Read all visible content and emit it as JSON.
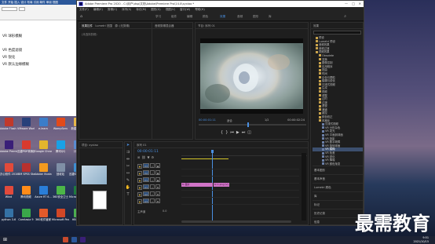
{
  "word": {
    "tab_labels": "文件  开始  插入  设计  布局  引用  邮件  审阅  视图",
    "lines": [
      "VR 球形模糊",
      "",
      "VR 色度滤镜",
      "VR 锐化",
      "VR 默认边缘模糊"
    ]
  },
  "desktop_icons": [
    {
      "label": "Adobe Flash Professio...",
      "color": "#c0392b"
    },
    {
      "label": "VMware Workstati...",
      "color": "#27407a"
    },
    {
      "label": "e-learn",
      "color": "#3b7dc9"
    },
    {
      "label": "WampServ",
      "color": "#e24a1b"
    },
    {
      "label": "新建文件夹",
      "color": "#e8b84a"
    },
    {
      "label": "Adobe Premiere ...",
      "color": "#3a1f78"
    },
    {
      "label": "迅捷PDF转换器 (v4.0)",
      "color": "#d83a2e"
    },
    {
      "label": "Google Chrome",
      "color": "#e3b52d"
    },
    {
      "label": "腾讯QQ",
      "color": "#1aa1e6"
    },
    {
      "label": "计算机",
      "color": "#5a8bd1"
    },
    {
      "label": "办公软件 2010",
      "color": "#e34a3a"
    },
    {
      "label": "IBM SPSS Statistics 20",
      "color": "#b8312f"
    },
    {
      "label": "Adobe Illustrat...",
      "color": "#f29a1f"
    },
    {
      "label": "回收站",
      "color": "#7f8fa6"
    },
    {
      "label": "迅捷OCR文字识别",
      "color": "#3e8ed0"
    },
    {
      "label": "Wind",
      "color": "#e14a3c"
    },
    {
      "label": "腾讯视频",
      "color": "#ff8c1a"
    },
    {
      "label": "Azure RT 6...",
      "color": "#2a7ed8"
    },
    {
      "label": "360安全卫士",
      "color": "#4cb648"
    },
    {
      "label": "Microsoft Excel 2010",
      "color": "#1e7b3f"
    },
    {
      "label": "python 3.6",
      "color": "#3572a5"
    },
    {
      "label": "Camtasia 9",
      "color": "#3aa84a"
    },
    {
      "label": "360软件管家",
      "color": "#e35a2a"
    },
    {
      "label": "Microsoft PowerPoint",
      "color": "#d24726"
    },
    {
      "label": "HBuilder",
      "color": "#4caf50"
    }
  ],
  "premiere": {
    "title": "Adobe Premiere Pro 2020 - C:\\用户\\dsp\\文档\\Adobe\\Premiere Pro\\14.0\\xyxiao *",
    "menu": [
      "文件(F)",
      "编辑(E)",
      "剪辑(C)",
      "序列(S)",
      "标记(M)",
      "图形(G)",
      "视图(V)",
      "窗口(W)",
      "帮助(H)"
    ],
    "workspaces": [
      "学习",
      "组件",
      "编辑",
      "颜色",
      "效果",
      "音频",
      "图形",
      "库"
    ],
    "active_workspace": "效果",
    "source_tabs": [
      "效果控件",
      "Lumetri 范围",
      "源: (无剪辑)"
    ],
    "source_empty": "(未选择剪辑)",
    "audio_mixer_tab": "音频剪辑混合器",
    "program_tab": "节目: 序列 01",
    "program_timecode": "00:00:01:11",
    "program_fit": "适合",
    "program_ratio": "1/2",
    "program_duration": "00:00:02:24",
    "project_tab": "项目: xyxiao",
    "timeline_tab": "序列 01",
    "timeline_timecode": "00:00:01:11",
    "tracks": [
      {
        "name": "V3"
      },
      {
        "name": "V2"
      },
      {
        "name": "V1"
      },
      {
        "name": "A1"
      },
      {
        "name": "A2"
      },
      {
        "name": "A3"
      }
    ],
    "master_label": "主声道",
    "master_value": "0.0",
    "clip_label_1": "fx 图片",
    "clip_label_2": "fx 1.png [V]",
    "clip_label_3": "fx 图片"
  },
  "effects_panel": {
    "tab": "效果",
    "search_placeholder": "",
    "items": [
      {
        "label": "预设",
        "indent": 1
      },
      {
        "label": "Lumetri 预设",
        "indent": 1
      },
      {
        "label": "音频效果",
        "indent": 1
      },
      {
        "label": "音频过渡",
        "indent": 1
      },
      {
        "label": "视频效果",
        "indent": 1
      },
      {
        "label": "Obsolete",
        "indent": 2
      },
      {
        "label": "变换",
        "indent": 2
      },
      {
        "label": "图像控制",
        "indent": 2
      },
      {
        "label": "实用程序",
        "indent": 2
      },
      {
        "label": "扭曲",
        "indent": 2
      },
      {
        "label": "时间",
        "indent": 2
      },
      {
        "label": "杂色与颗粒",
        "indent": 2
      },
      {
        "label": "模糊与锐化",
        "indent": 2
      },
      {
        "label": "沉浸式视频",
        "indent": 2
      },
      {
        "label": "生成",
        "indent": 2
      },
      {
        "label": "视频",
        "indent": 2
      },
      {
        "label": "调整",
        "indent": 2
      },
      {
        "label": "过时",
        "indent": 2
      },
      {
        "label": "过渡",
        "indent": 2
      },
      {
        "label": "透视",
        "indent": 2
      },
      {
        "label": "通道",
        "indent": 2
      },
      {
        "label": "键控",
        "indent": 2
      },
      {
        "label": "颜色校正",
        "indent": 2
      },
      {
        "label": "风格化",
        "indent": 2
      },
      {
        "label": "沉浸式视频",
        "indent": 3
      },
      {
        "label": "VR 分形杂色",
        "indent": 3
      },
      {
        "label": "VR 发光",
        "indent": 3
      },
      {
        "label": "VR 平面到球面",
        "indent": 3
      },
      {
        "label": "VR 投影",
        "indent": 3
      },
      {
        "label": "VR 数字故障",
        "indent": 3
      },
      {
        "label": "VR 旋转球面",
        "indent": 3
      },
      {
        "label": "VR 模糊",
        "indent": 3
      },
      {
        "label": "VR 色差",
        "indent": 3
      },
      {
        "label": "VR 锐化",
        "indent": 3
      },
      {
        "label": "VR 降噪",
        "indent": 3
      },
      {
        "label": "VR 颜色渐变",
        "indent": 3
      }
    ],
    "selected_index": 31,
    "lower_items": [
      "基本图形",
      "基本声音",
      "Lumetri 颜色",
      "库",
      "标记",
      "历史记录",
      "信息"
    ]
  },
  "taskbar": {
    "time": "9:51",
    "date": "2021/10/15"
  },
  "watermark": "最需教育"
}
